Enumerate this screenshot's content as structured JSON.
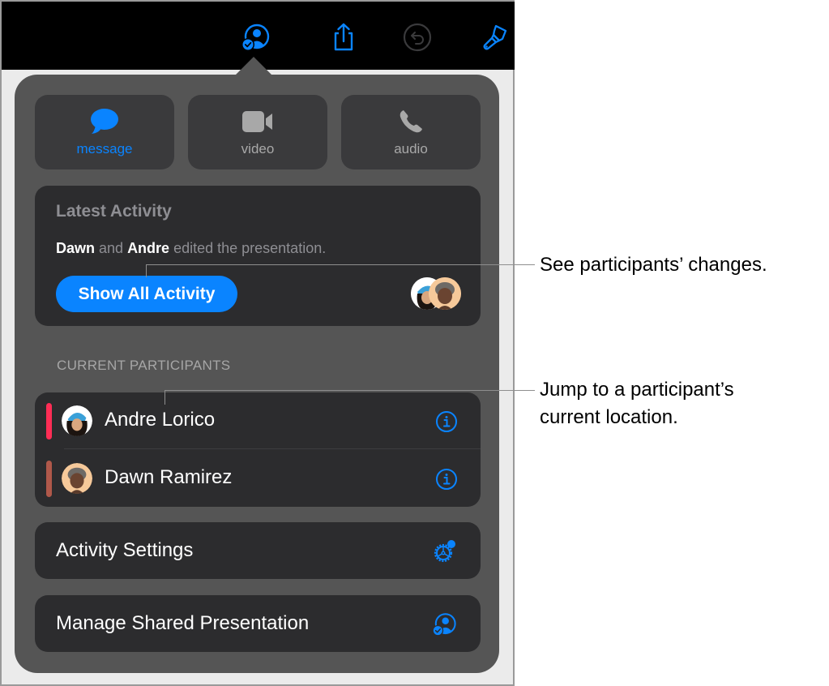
{
  "toolbar": {
    "icons": [
      {
        "name": "collaboration-icon",
        "state": "active",
        "color": "#0a84ff"
      },
      {
        "name": "share-icon",
        "color": "#0a84ff"
      },
      {
        "name": "undo-icon",
        "state": "disabled",
        "color": "#3a3a3a"
      },
      {
        "name": "format-brush-icon",
        "color": "#0a84ff"
      }
    ]
  },
  "actions": [
    {
      "label": "message",
      "icon": "message-bubble-icon",
      "active": true
    },
    {
      "label": "video",
      "icon": "video-camera-icon",
      "active": false
    },
    {
      "label": "audio",
      "icon": "phone-icon",
      "active": false
    }
  ],
  "latest_activity": {
    "title": "Latest Activity",
    "name1": "Dawn",
    "conj": " and ",
    "name2": "Andre",
    "rest": " edited the presentation.",
    "button": "Show All Activity"
  },
  "participants": {
    "section_label": "CURRENT PARTICIPANTS",
    "list": [
      {
        "name": "Andre Lorico",
        "color": "#ff2d55"
      },
      {
        "name": "Dawn Ramirez",
        "color": "#b0584a"
      }
    ]
  },
  "activity_settings": {
    "label": "Activity Settings"
  },
  "manage": {
    "label": "Manage Shared Presentation"
  },
  "callouts": [
    {
      "text": "See participants’ changes."
    },
    {
      "line1": "Jump to a participant’s",
      "line2": "current location."
    }
  ],
  "colors": {
    "accent": "#0a84ff",
    "popover_bg": "#555555",
    "card_bg": "#2c2c2e"
  }
}
